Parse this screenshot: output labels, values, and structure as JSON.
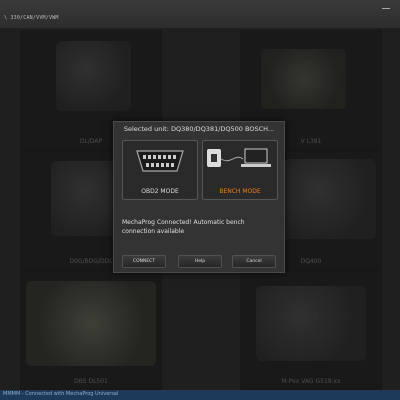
{
  "window": {
    "path": "\\ 330/CAN/VVM/VWM"
  },
  "grid": {
    "units": [
      {
        "label": "DL/DAP"
      },
      {
        "label": "V L381"
      },
      {
        "label": "D0G/BDG/DDL"
      },
      {
        "label": "DQ400"
      },
      {
        "label": "DBS DL501"
      },
      {
        "label": "M-Pex VAG G519.xx"
      }
    ]
  },
  "dialog": {
    "title": "Selected unit: DQ380/DQ381/DQ500 BOSCH...",
    "obd_label": "OBD2 MODE",
    "bench_label": "BENCH MODE",
    "message": "MechaProg Connected! Automatic bench connection available",
    "connect_label": "CONNECT",
    "help_label": "Help",
    "cancel_label": "Cancel"
  },
  "status": {
    "text": "MMMM - Connected with MechaProg Universal"
  },
  "colors": {
    "accent": "#e8801e",
    "status_bg": "#1e3a5a"
  }
}
